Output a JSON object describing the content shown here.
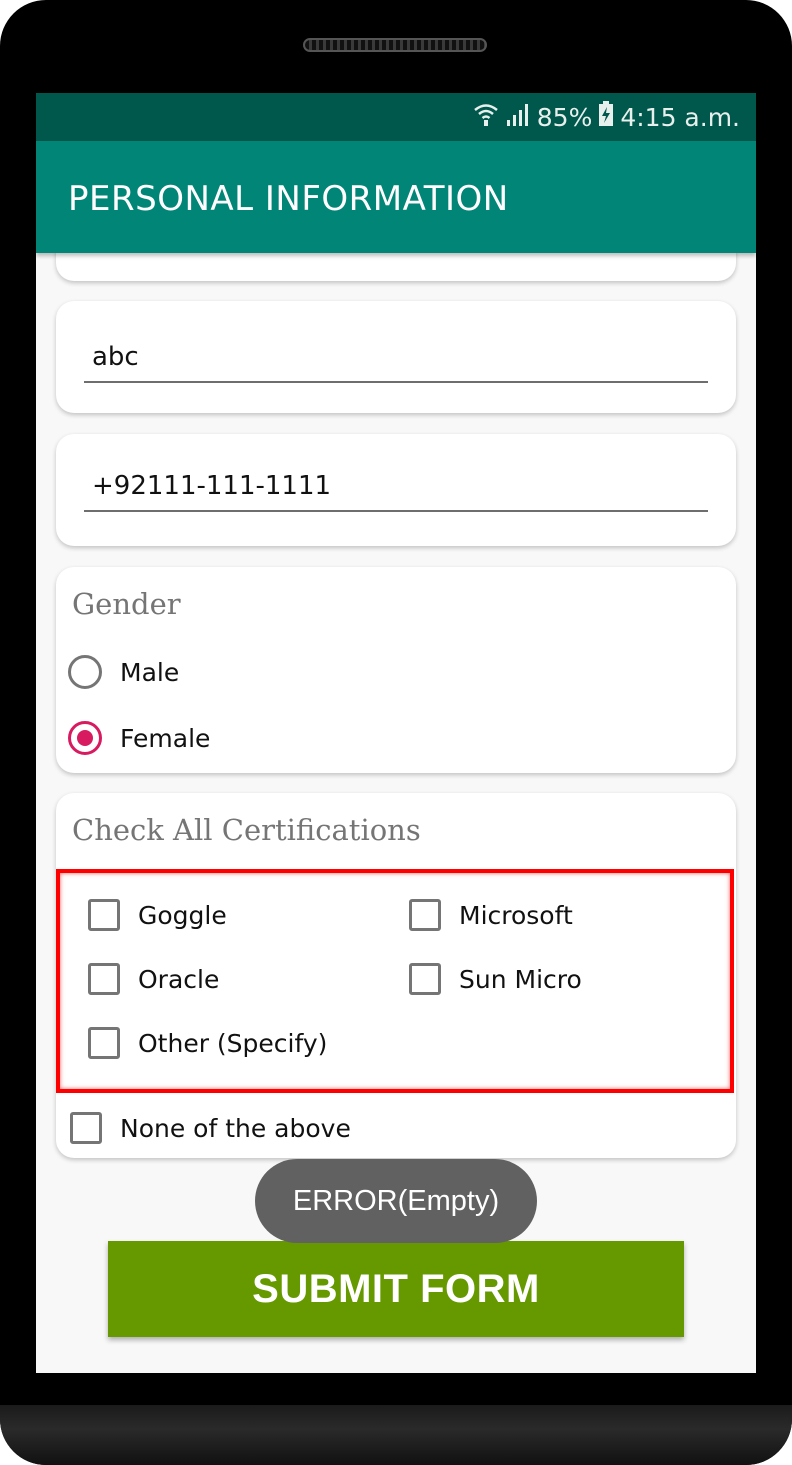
{
  "status_bar": {
    "battery_percent": "85%",
    "time": "4:15 a.m."
  },
  "app_bar": {
    "title": "PERSONAL INFORMATION"
  },
  "fields": {
    "name_value": "abc",
    "phone_value": "+92111-111-1111"
  },
  "gender": {
    "title": "Gender",
    "options": [
      {
        "label": "Male",
        "selected": false
      },
      {
        "label": "Female",
        "selected": true
      }
    ]
  },
  "certifications": {
    "title": "Check All Certifications",
    "options": [
      {
        "label": "Goggle",
        "checked": false
      },
      {
        "label": "Microsoft",
        "checked": false
      },
      {
        "label": "Oracle",
        "checked": false
      },
      {
        "label": "Sun Micro",
        "checked": false
      },
      {
        "label": "Other (Specify)",
        "checked": false
      }
    ],
    "none_label": "None of the above"
  },
  "toast": {
    "text": "ERROR(Empty)"
  },
  "submit": {
    "label": "SUBMIT FORM"
  },
  "colors": {
    "status_bar": "#00574b",
    "app_bar": "#008577",
    "radio_accent": "#d81b60",
    "submit_button": "#669900",
    "error_outline": "#ff0000"
  }
}
